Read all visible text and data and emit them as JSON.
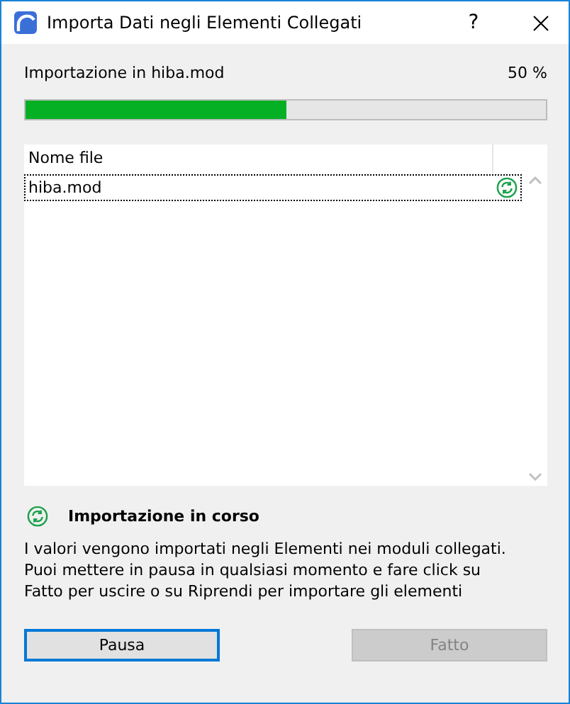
{
  "window": {
    "title": "Importa Dati negli Elementi Collegati",
    "help": "?"
  },
  "progress": {
    "label": "Importazione in hiba.mod",
    "percent": "50 %",
    "level": 0.5
  },
  "table": {
    "columns": [
      "Nome file"
    ],
    "rows": [
      {
        "name": "hiba.mod",
        "selected": true,
        "kind": "importing"
      }
    ]
  },
  "status": {
    "text": "Importazione in corso"
  },
  "description": [
    "I valori vengono importati negli Elementi nei moduli collegati.",
    "Puoi mettere in pausa in qualsiasi momento e fare click su",
    "Fatto per uscire o su Riprendi per importare gli elementi"
  ],
  "buttons": [
    {
      "label": "Pausa",
      "disabled": false,
      "focused": true
    },
    {
      "label": "Fatto",
      "disabled": true,
      "focused": false
    }
  ]
}
